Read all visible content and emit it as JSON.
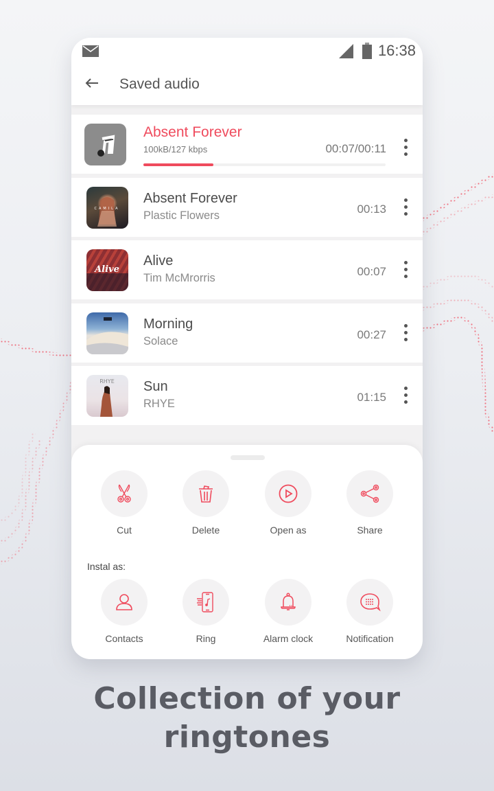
{
  "status_bar": {
    "time": "16:38",
    "icons": [
      "mail-icon",
      "signal-icon",
      "battery-icon"
    ]
  },
  "app_bar": {
    "back_icon": "arrow-left-icon",
    "title": "Saved audio"
  },
  "now_playing": {
    "title": "Absent Forever",
    "meta": "100kB/127 kbps",
    "position": "00:07/00:11",
    "progress_percent": 29,
    "icon": "music-note-icon"
  },
  "tracks": [
    {
      "title": "Absent Forever",
      "artist": "Plastic Flowers",
      "duration": "00:13",
      "cover": "camila-cover"
    },
    {
      "title": "Alive",
      "artist": "Tim McMrorris",
      "duration": "00:07",
      "cover": "alive-cover"
    },
    {
      "title": "Morning",
      "artist": "Solace",
      "duration": "00:27",
      "cover": "desert-cover"
    },
    {
      "title": "Sun",
      "artist": "RHYE",
      "duration": "01:15",
      "cover": "rhye-cover"
    }
  ],
  "sheet": {
    "actions": [
      {
        "label": "Cut",
        "icon": "scissors-icon"
      },
      {
        "label": "Delete",
        "icon": "trash-icon"
      },
      {
        "label": "Open as",
        "icon": "play-circle-icon"
      },
      {
        "label": "Share",
        "icon": "share-icon"
      }
    ],
    "install_label": "Instal as:",
    "install_options": [
      {
        "label": "Contacts",
        "icon": "user-icon"
      },
      {
        "label": "Ring",
        "icon": "phone-ring-icon"
      },
      {
        "label": "Alarm clock",
        "icon": "bell-icon"
      },
      {
        "label": "Notification",
        "icon": "message-icon"
      }
    ]
  },
  "tagline": {
    "line1": "Collection of your",
    "line2": "ringtones"
  },
  "colors": {
    "accent": "#ef4b5d",
    "text": "#4b4b4b",
    "muted": "#8a8a8a",
    "icon_bg": "#f3f2f3",
    "headline": "#5a5c64"
  }
}
